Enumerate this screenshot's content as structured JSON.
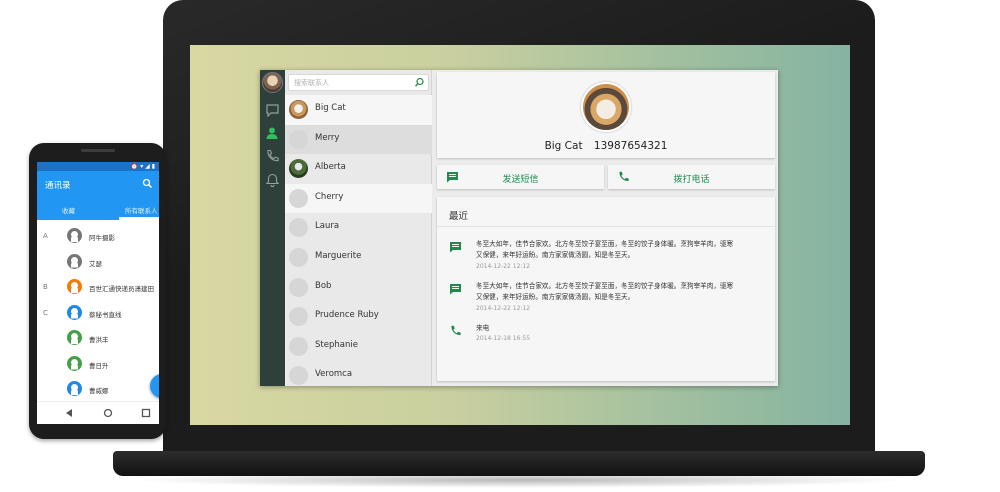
{
  "laptop_app": {
    "search": {
      "placeholder": "搜索联系人"
    },
    "contacts": [
      {
        "name": "Big Cat",
        "avatar": "cat-photo"
      },
      {
        "name": "Merry",
        "avatar": "default"
      },
      {
        "name": "Alberta",
        "avatar": "photo"
      },
      {
        "name": "Cherry",
        "avatar": "default"
      },
      {
        "name": "Laura",
        "avatar": "default"
      },
      {
        "name": "Marguerite",
        "avatar": "default"
      },
      {
        "name": "Bob",
        "avatar": "default"
      },
      {
        "name": "Prudence Ruby",
        "avatar": "default"
      },
      {
        "name": "Stephanie",
        "avatar": "default"
      },
      {
        "name": "Veromca",
        "avatar": "default"
      }
    ],
    "detail": {
      "name": "Big Cat",
      "phone": "13987654321",
      "sms_button": "发送短信",
      "call_button": "拨打电话",
      "recent_title": "最近",
      "recent": [
        {
          "type": "sms",
          "text": "冬至大如年，佳节合家欢。北方冬至饺子宴至面，冬至的饺子身体暖。烹狗宰羊肉，驱寒又保健，来年好运盼。南方家家做汤圆，知是冬至天。",
          "time": "2014-12-22  12:12"
        },
        {
          "type": "sms",
          "text": "冬至大如年，佳节合家欢。北方冬至饺子宴至面，冬至的饺子身体暖。烹狗宰羊肉，驱寒又保健，来年好运盼。南方家家做汤圆，知是冬至天。",
          "time": "2014-12-22  12:12"
        },
        {
          "type": "call",
          "text": "来电",
          "time": "2014-12-18  16:55"
        }
      ]
    },
    "colors": {
      "accent": "#1f8a4c",
      "rail": "#2f3f3a"
    }
  },
  "phone_app": {
    "title": "通讯录",
    "tabs": [
      "收藏",
      "所有联系人"
    ],
    "contacts": [
      {
        "letter": "A",
        "name": "阿牛摄影",
        "color": "#757575"
      },
      {
        "letter": "",
        "name": "艾瑟",
        "color": "#757575"
      },
      {
        "letter": "B",
        "name": "百世汇通快递员潇建田",
        "color": "#f57c00"
      },
      {
        "letter": "C",
        "name": "蔡秘书直线",
        "color": "#1e88e5"
      },
      {
        "letter": "",
        "name": "曹洪丰",
        "color": "#43a047"
      },
      {
        "letter": "",
        "name": "曹日升",
        "color": "#43a047"
      },
      {
        "letter": "",
        "name": "曹威娜",
        "color": "#1e88e5"
      }
    ],
    "colors": {
      "primary": "#2196f3",
      "status": "#1e72c6"
    }
  }
}
